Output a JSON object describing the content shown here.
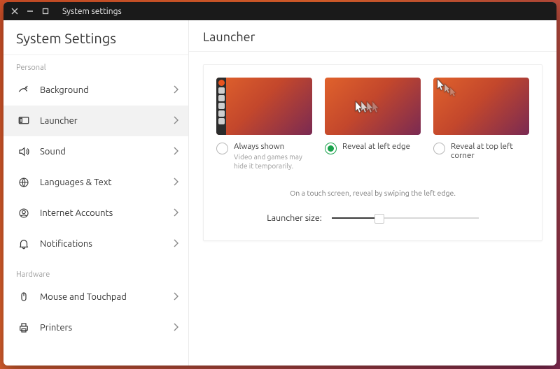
{
  "window": {
    "title": "System settings"
  },
  "sidebar": {
    "title": "System Settings",
    "groups": [
      {
        "label": "Personal",
        "items": [
          {
            "id": "background",
            "label": "Background",
            "icon": "background-icon"
          },
          {
            "id": "launcher",
            "label": "Launcher",
            "icon": "launcher-icon",
            "active": true
          },
          {
            "id": "sound",
            "label": "Sound",
            "icon": "sound-icon"
          },
          {
            "id": "languages",
            "label": "Languages & Text",
            "icon": "globe-icon"
          },
          {
            "id": "accounts",
            "label": "Internet Accounts",
            "icon": "person-icon"
          },
          {
            "id": "notifications",
            "label": "Notifications",
            "icon": "bell-icon"
          }
        ]
      },
      {
        "label": "Hardware",
        "items": [
          {
            "id": "mouse",
            "label": "Mouse and Touchpad",
            "icon": "mouse-icon"
          },
          {
            "id": "printers",
            "label": "Printers",
            "icon": "printer-icon"
          }
        ]
      }
    ]
  },
  "page": {
    "title": "Launcher",
    "options": [
      {
        "id": "always",
        "label": "Always shown",
        "desc": "Video and games may hide it temporarily.",
        "checked": false
      },
      {
        "id": "edge",
        "label": "Reveal at left edge",
        "desc": "",
        "checked": true
      },
      {
        "id": "corner",
        "label": "Reveal at top left corner",
        "desc": "",
        "checked": false
      }
    ],
    "hint": "On a touch screen, reveal by swiping the left edge.",
    "size_label": "Launcher size:",
    "size_value_pct": 32
  }
}
